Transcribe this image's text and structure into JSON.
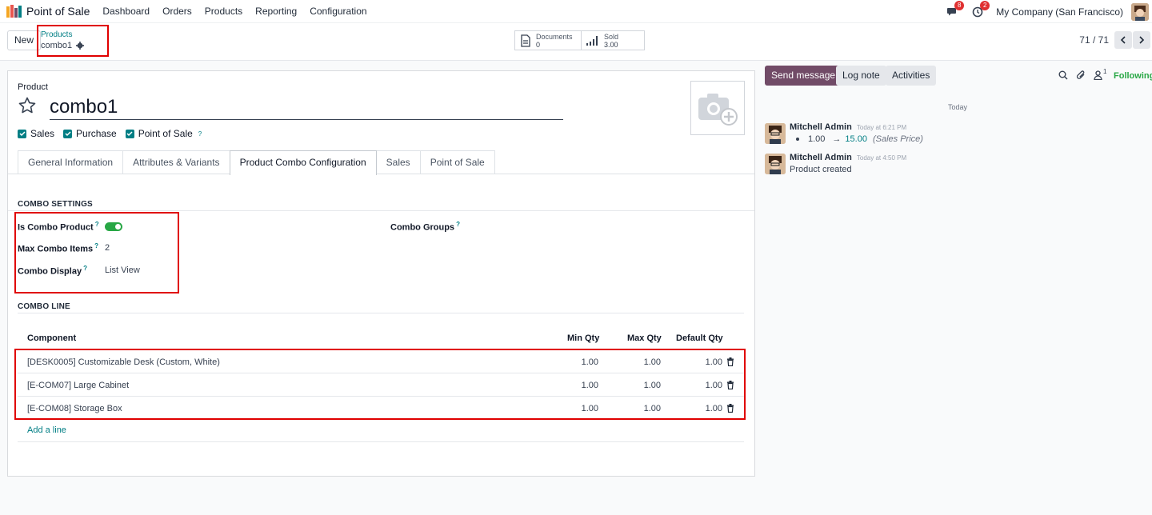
{
  "nav": {
    "app_name": "Point of Sale",
    "menu": [
      "Dashboard",
      "Orders",
      "Products",
      "Reporting",
      "Configuration"
    ],
    "chat_badge": "8",
    "activity_badge": "2",
    "company": "My Company (San Francisco)"
  },
  "control": {
    "new_label": "New",
    "breadcrumb_parent": "Products",
    "breadcrumb_current": "combo1",
    "documents_label": "Documents",
    "documents_value": "0",
    "sold_label": "Sold",
    "sold_value": "3.00",
    "pager": "71 / 71"
  },
  "form": {
    "product_label": "Product",
    "product_name": "combo1",
    "checks": [
      {
        "label": "Sales",
        "checked": true
      },
      {
        "label": "Purchase",
        "checked": true
      },
      {
        "label": "Point of Sale",
        "checked": true,
        "help": "?"
      }
    ],
    "tabs": [
      "General Information",
      "Attributes & Variants",
      "Product Combo Configuration",
      "Sales",
      "Point of Sale"
    ],
    "active_tab": "Product Combo Configuration"
  },
  "combo_settings": {
    "title": "COMBO SETTINGS",
    "is_combo_label": "Is Combo Product",
    "is_combo_value": true,
    "max_items_label": "Max Combo Items",
    "max_items_value": "2",
    "display_label": "Combo Display",
    "display_value": "List View",
    "groups_label": "Combo Groups",
    "help": "?"
  },
  "combo_line": {
    "title": "COMBO LINE",
    "headers": [
      "Component",
      "Min Qty",
      "Max Qty",
      "Default Qty"
    ],
    "rows": [
      {
        "component": "[DESK0005] Customizable Desk (Custom, White)",
        "min": "1.00",
        "max": "1.00",
        "default": "1.00"
      },
      {
        "component": "[E-COM07] Large Cabinet",
        "min": "1.00",
        "max": "1.00",
        "default": "1.00"
      },
      {
        "component": "[E-COM08] Storage Box",
        "min": "1.00",
        "max": "1.00",
        "default": "1.00"
      }
    ],
    "add_line": "Add a line"
  },
  "chatter": {
    "send_message": "Send message",
    "log_note": "Log note",
    "activities": "Activities",
    "followers_count": "1",
    "following": "Following",
    "today": "Today",
    "messages": [
      {
        "author": "Mitchell Admin",
        "time": "Today at 6:21 PM",
        "old_value": "1.00",
        "new_value": "15.00",
        "field": "(Sales Price)"
      },
      {
        "author": "Mitchell Admin",
        "time": "Today at 4:50 PM",
        "body": "Product created"
      }
    ]
  },
  "colors": {
    "accent": "#017e84",
    "primary": "#714b67",
    "highlight": "#e00000"
  }
}
